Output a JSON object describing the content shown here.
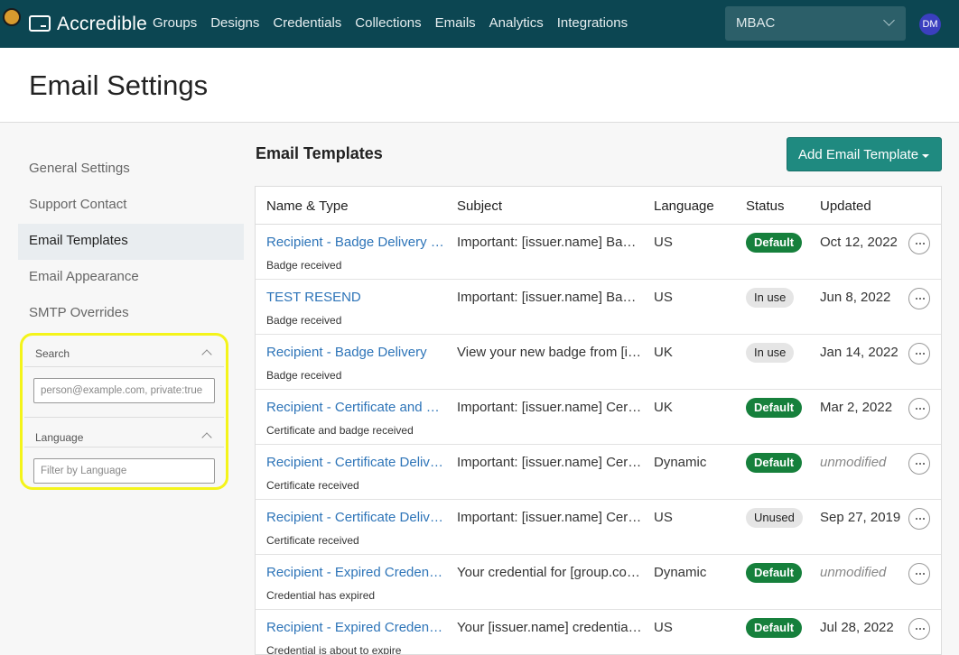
{
  "app": {
    "logo_text": "Accredible"
  },
  "nav": [
    "Groups",
    "Designs",
    "Credentials",
    "Collections",
    "Emails",
    "Analytics",
    "Integrations"
  ],
  "org_select": {
    "value": "MBAC"
  },
  "user": {
    "initials": "DM"
  },
  "page_title": "Email Settings",
  "sidebar": {
    "items": [
      {
        "label": "General Settings"
      },
      {
        "label": "Support Contact"
      },
      {
        "label": "Email Templates"
      },
      {
        "label": "Email Appearance"
      },
      {
        "label": "SMTP Overrides"
      }
    ]
  },
  "filters": {
    "search_label": "Search",
    "search_placeholder": "person@example.com, private:true",
    "language_label": "Language",
    "language_placeholder": "Filter by Language"
  },
  "content": {
    "title": "Email Templates",
    "add_button_label": "Add Email Template"
  },
  "table": {
    "headers": [
      "Name & Type",
      "Subject",
      "Language",
      "Status",
      "Updated"
    ],
    "rows": [
      {
        "name": "Recipient - Badge Delivery D…",
        "type": "Badge received",
        "subject": "Important: [issuer.name] Bad…",
        "language": "US",
        "status": "Default",
        "updated": "Oct 12, 2022"
      },
      {
        "name": "TEST RESEND",
        "type": "Badge received",
        "subject": "Important: [issuer.name] Bad…",
        "language": "US",
        "status": "In use",
        "updated": "Jun 8, 2022"
      },
      {
        "name": "Recipient - Badge Delivery",
        "type": "Badge received",
        "subject": "View your new badge from [is…",
        "language": "UK",
        "status": "In use",
        "updated": "Jan 14, 2022"
      },
      {
        "name": "Recipient - Certificate and B…",
        "type": "Certificate and badge received",
        "subject": "Important: [issuer.name] Cert…",
        "language": "UK",
        "status": "Default",
        "updated": "Mar 2, 2022"
      },
      {
        "name": "Recipient - Certificate Delivery",
        "type": "Certificate received",
        "subject": "Important: [issuer.name] Cert…",
        "language": "Dynamic",
        "status": "Default",
        "updated": "unmodified"
      },
      {
        "name": "Recipient - Certificate Delive…",
        "type": "Certificate received",
        "subject": "Important: [issuer.name] Cert…",
        "language": "US",
        "status": "Unused",
        "updated": "Sep 27, 2019"
      },
      {
        "name": "Recipient - Expired Credenti…",
        "type": "Credential has expired",
        "subject": "Your credential for [group.co…",
        "language": "Dynamic",
        "status": "Default",
        "updated": "unmodified"
      },
      {
        "name": "Recipient - Expired Credenti…",
        "type": "Credential is about to expire",
        "subject": "Your [issuer.name] credential …",
        "language": "US",
        "status": "Default",
        "updated": "Jul 28, 2022"
      }
    ]
  },
  "colors": {
    "topbar": "#0c4652",
    "accent": "#1f8a80",
    "status_default": "#16803c",
    "link": "#2d74b8",
    "highlight": "#f4f41a"
  }
}
